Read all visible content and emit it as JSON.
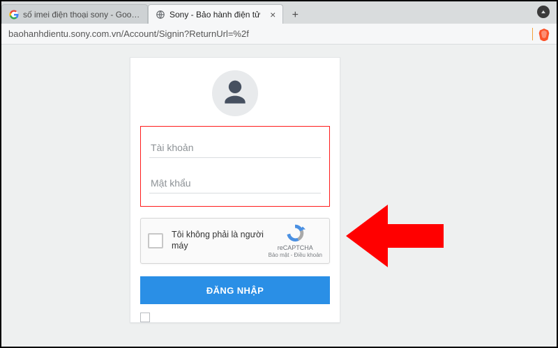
{
  "tabs": [
    {
      "title": "số imei điện thoại sony - Google Tìm",
      "active": false,
      "favicon": "google"
    },
    {
      "title": "Sony - Bảo hành điện tử",
      "active": true,
      "favicon": "globe"
    }
  ],
  "address_url": "baohanhdientu.sony.com.vn/Account/Signin?ReturnUrl=%2f",
  "login": {
    "username_placeholder": "Tài khoản",
    "password_placeholder": "Mật khẩu",
    "button_label": "ĐĂNG NHẬP"
  },
  "recaptcha": {
    "label": "Tôi không phải là người máy",
    "brand": "reCAPTCHA",
    "legal": "Bảo mật - Điều khoản"
  },
  "colors": {
    "accent": "#2a8fe6",
    "highlight_border": "#ff1a1a"
  }
}
